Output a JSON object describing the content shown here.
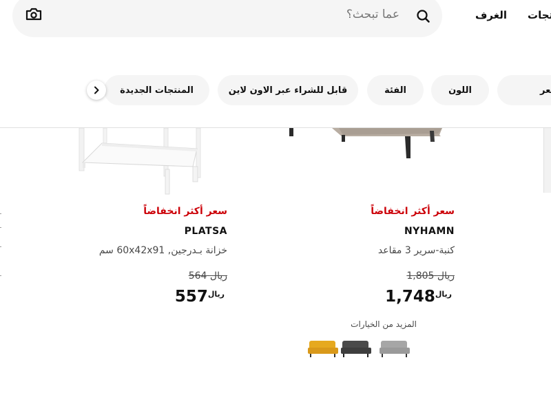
{
  "header": {
    "search_placeholder": "عما تبحث؟",
    "nav_rooms": "الغرف",
    "nav_products": "المنتجات"
  },
  "filters": {
    "price": "السعر",
    "color": "اللون",
    "category": "الفئة",
    "online": "قابل للشراء عبر الاون لاين",
    "new_products": "المنتجات الجديدة"
  },
  "products": [
    {
      "promo": "سعر أكثر انخفاضاً",
      "name": "NYHAMN",
      "description": "كنبة-سرير 3 مقاعد",
      "old_price": "1,805",
      "old_currency": "ريال",
      "price": "1,748",
      "currency": "ريال",
      "more_options": "المزيد من الخيارات",
      "swatches": [
        {
          "name": "light-grey",
          "color": "#a6a6a6"
        },
        {
          "name": "dark-grey",
          "color": "#4a4a4a"
        },
        {
          "name": "yellow",
          "color": "#e6a91f"
        }
      ]
    },
    {
      "promo": "سعر أكثر انخفاضاً",
      "name": "PLATSA",
      "description": "خزانة بـدرجين, 60x42x91 سم",
      "old_price": "564",
      "old_currency": "ريال",
      "price": "557",
      "currency": "ريال"
    }
  ],
  "colors": {
    "promo_red": "#cc0008",
    "chip_bg": "#f5f5f5",
    "text": "#111111",
    "muted": "#484848"
  }
}
